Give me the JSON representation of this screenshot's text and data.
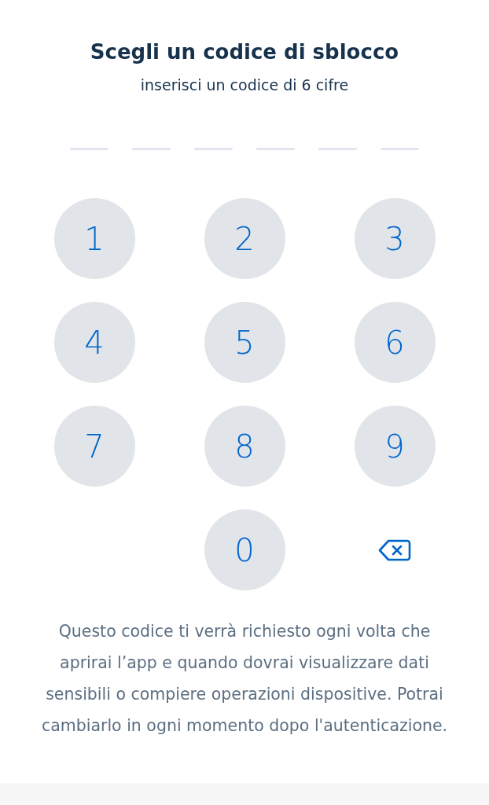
{
  "title": "Scegli un codice di sblocco",
  "subtitle": "inserisci un codice di 6 cifre",
  "code_slots": [
    {
      "filled": false
    },
    {
      "filled": false
    },
    {
      "filled": false
    },
    {
      "filled": false
    },
    {
      "filled": false
    },
    {
      "filled": false
    }
  ],
  "keypad": [
    {
      "kind": "digit",
      "label": "1"
    },
    {
      "kind": "digit",
      "label": "2"
    },
    {
      "kind": "digit",
      "label": "3"
    },
    {
      "kind": "digit",
      "label": "4"
    },
    {
      "kind": "digit",
      "label": "5"
    },
    {
      "kind": "digit",
      "label": "6"
    },
    {
      "kind": "digit",
      "label": "7"
    },
    {
      "kind": "digit",
      "label": "8"
    },
    {
      "kind": "digit",
      "label": "9"
    },
    {
      "kind": "blank"
    },
    {
      "kind": "digit",
      "label": "0"
    },
    {
      "kind": "backspace"
    }
  ],
  "note": "Questo codice ti verrà richiesto ogni volta che aprirai l’app e quando dovrai visualizzare dati sensibili o compiere operazioni dispositive. Potrai cambiarlo in ogni momento dopo l'autenticazione."
}
